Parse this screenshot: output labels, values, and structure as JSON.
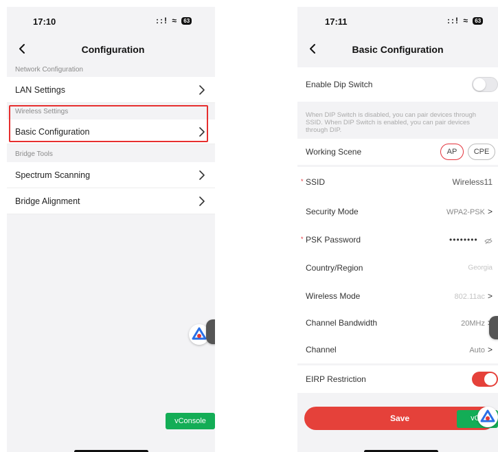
{
  "left": {
    "status": {
      "time": "17:10",
      "signal": "::!",
      "wifi": "≈",
      "battery": "63"
    },
    "nav": {
      "title": "Configuration"
    },
    "sections": [
      {
        "header": "Network Configuration",
        "items": [
          "LAN Settings"
        ]
      },
      {
        "header": "Wireless Settings",
        "items": [
          "Basic Configuration"
        ]
      },
      {
        "header": "Bridge Tools",
        "items": [
          "Spectrum Scanning",
          "Bridge Alignment"
        ]
      }
    ],
    "vconsole": "vConsole"
  },
  "right": {
    "status": {
      "time": "17:11",
      "signal": "::!",
      "wifi": "≈",
      "battery": "63"
    },
    "nav": {
      "title": "Basic Configuration"
    },
    "enable_dip": {
      "label": "Enable Dip Switch",
      "on": false
    },
    "dip_info": "When DIP Switch is disabled, you can pair devices through SSID. When DIP Switch is enabled, you can pair devices through DIP.",
    "working_scene": {
      "label": "Working Scene",
      "options": [
        "AP",
        "CPE"
      ],
      "selected": "AP"
    },
    "ssid": {
      "required_mark": "*",
      "label": "SSID",
      "value": "Wireless11"
    },
    "security_mode": {
      "label": "Security Mode",
      "value": "WPA2-PSK"
    },
    "psk_password": {
      "required_mark": "*",
      "label": "PSK Password",
      "value": "••••••••"
    },
    "country_region": {
      "label": "Country/Region",
      "value": "Georgia"
    },
    "wireless_mode": {
      "label": "Wireless Mode",
      "value": "802.11ac"
    },
    "channel_bandwidth": {
      "label": "Channel Bandwidth",
      "value": "20MHz"
    },
    "channel": {
      "label": "Channel",
      "value": "Auto"
    },
    "eirp": {
      "label": "EIRP Restriction",
      "on": true
    },
    "save": "Save",
    "vconsole": "vCo"
  },
  "colors": {
    "accent": "#e5413a",
    "vconsole": "#13ad56",
    "highlight": "#e62e2e"
  }
}
